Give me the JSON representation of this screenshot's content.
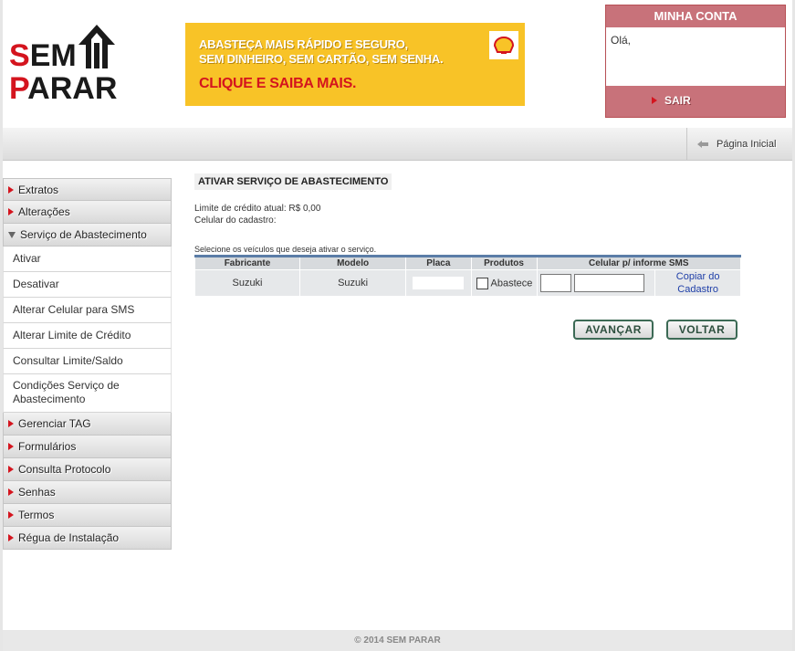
{
  "header": {
    "logo_line1": "SEM",
    "logo_line2": "PARAR",
    "banner": {
      "line1": "ABASTEÇA MAIS RÁPIDO E SEGURO,",
      "line2": "SEM DINHEIRO, SEM CARTÃO, SEM SENHA.",
      "cta": "CLIQUE E SAIBA MAIS."
    },
    "account": {
      "title": "MINHA CONTA",
      "greeting": "Olá,",
      "logout_label": "SAIR"
    }
  },
  "navbar": {
    "home_label": "Página Inicial"
  },
  "sidebar": {
    "cat_extratos": "Extratos",
    "cat_alteracoes": "Alterações",
    "cat_abastecimento": "Serviço de Abastecimento",
    "sub_items": [
      "Ativar",
      "Desativar",
      "Alterar Celular para SMS",
      "Alterar Limite de Crédito",
      "Consultar Limite/Saldo",
      "Condições Serviço de Abastecimento"
    ],
    "cat_tag": "Gerenciar TAG",
    "cat_formularios": "Formulários",
    "cat_protocolo": "Consulta Protocolo",
    "cat_senhas": "Senhas",
    "cat_termos": "Termos",
    "cat_regua": "Régua de Instalação"
  },
  "main": {
    "title": "ATIVAR SERVIÇO DE ABASTECIMENTO",
    "credit_limit": "Limite de crédito atual: R$ 0,00",
    "phone_registered": "Celular do cadastro:",
    "instruction": "Selecione os veículos que deseja ativar o serviço.",
    "table": {
      "headers": [
        "Fabricante",
        "Modelo",
        "Placa",
        "Produtos",
        "Celular p/ informe SMS"
      ],
      "row": {
        "manufacturer": "Suzuki",
        "model": "Suzuki",
        "plate": "",
        "product_label": "Abastece",
        "product_checked": false,
        "ddd": "",
        "phone": "",
        "copy_link": "Copiar do Cadastro"
      }
    },
    "next_button": "AVANÇAR",
    "back_button": "VOLTAR"
  },
  "footer": {
    "copyright": "© 2014 SEM PARAR"
  },
  "colors": {
    "brand_red": "#d4141e",
    "banner_yellow": "#f8c327",
    "account_rose": "#c8727a",
    "table_blue": "#5b7da7"
  }
}
